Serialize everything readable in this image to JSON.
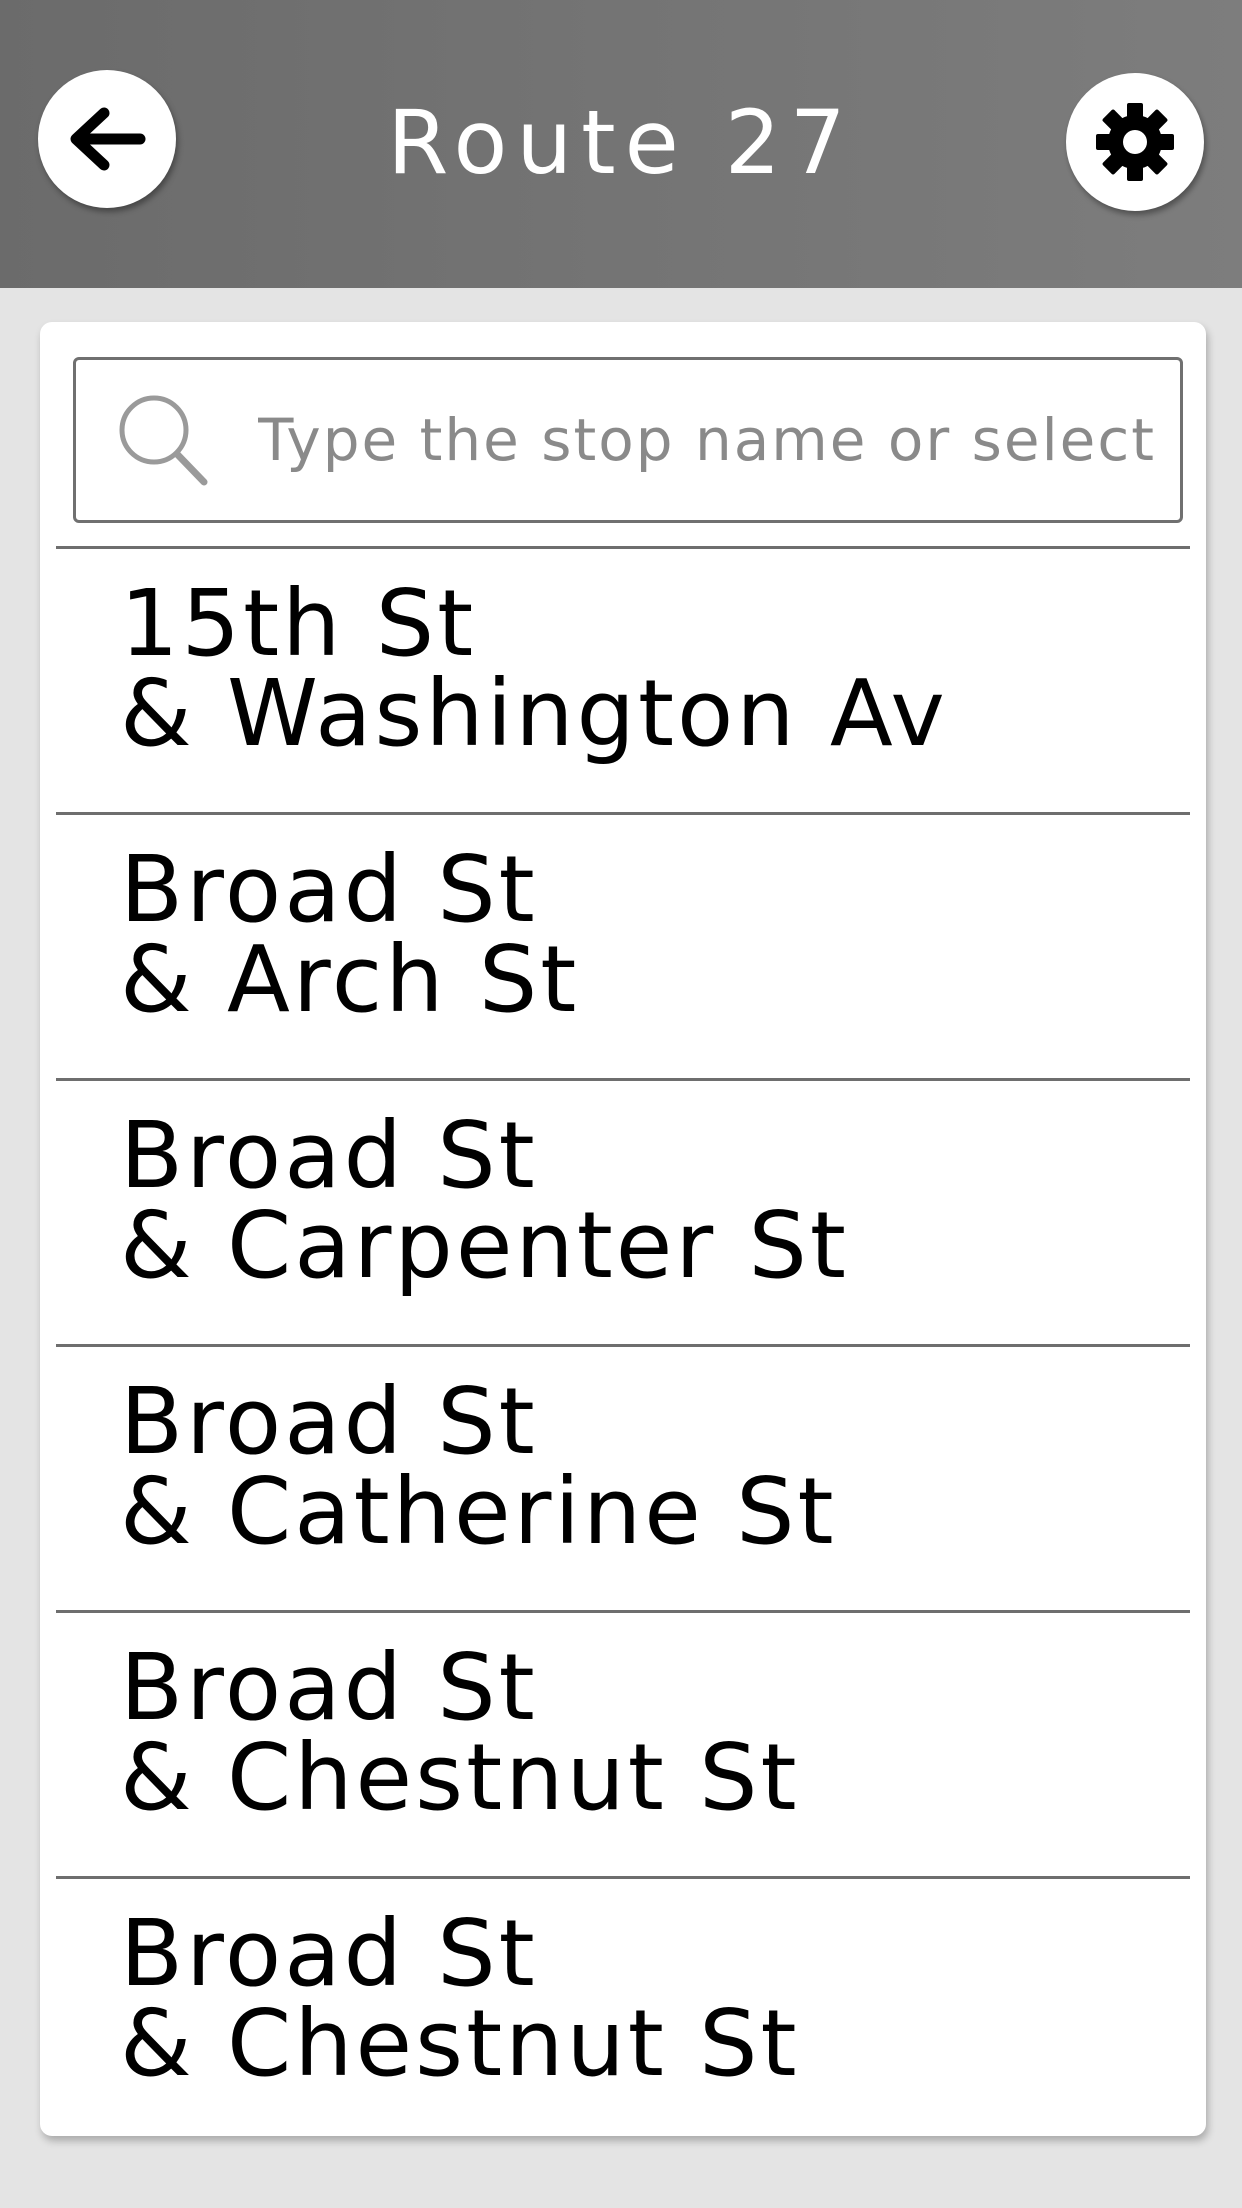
{
  "header": {
    "title": "Route 27",
    "back_icon": "arrow-left-icon",
    "settings_icon": "gear-icon"
  },
  "search": {
    "placeholder": "Type the stop name or select",
    "value": "",
    "icon": "search-icon"
  },
  "stops": [
    {
      "line1": "15th St",
      "line2": "& Washington Av"
    },
    {
      "line1": "Broad St",
      "line2": "& Arch St"
    },
    {
      "line1": "Broad St",
      "line2": "& Carpenter St"
    },
    {
      "line1": "Broad St",
      "line2": "& Catherine St"
    },
    {
      "line1": "Broad St",
      "line2": "& Chestnut St"
    },
    {
      "line1": "Broad St",
      "line2": "& Chestnut St"
    }
  ],
  "colors": {
    "header_background": "#747474",
    "page_background": "#e4e4e4",
    "card_background": "#ffffff",
    "divider": "#6e6e6e",
    "header_text": "#ffffff"
  }
}
